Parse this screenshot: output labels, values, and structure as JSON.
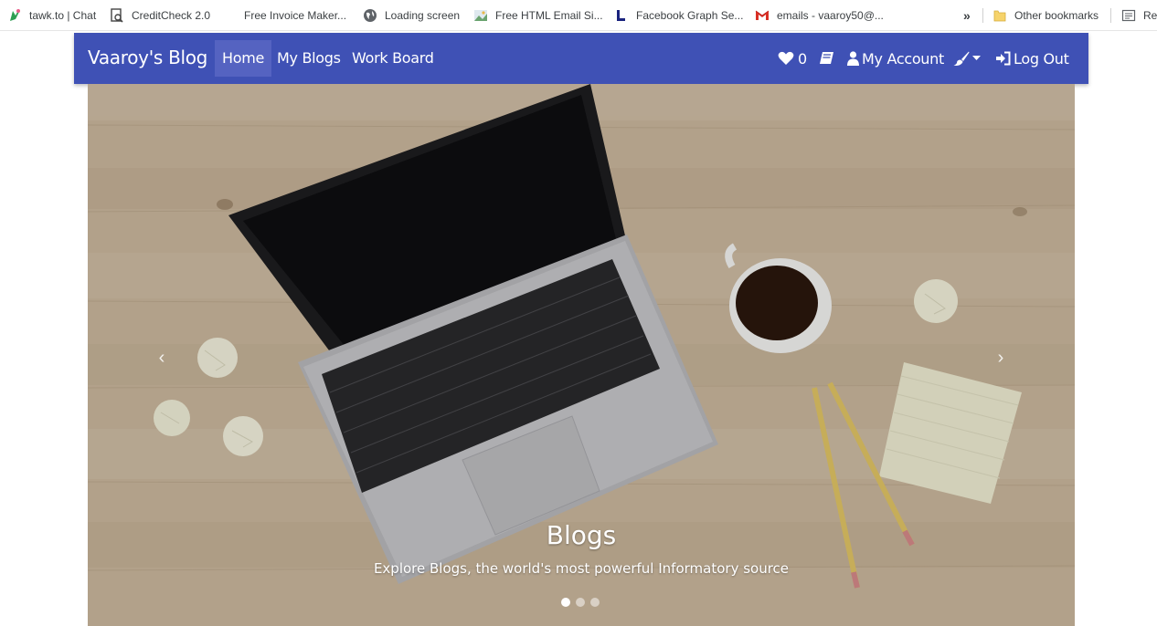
{
  "bookmarks": {
    "items": [
      {
        "label": "tawk.to | Chat",
        "icon": "tawk-icon"
      },
      {
        "label": "CreditCheck 2.0",
        "icon": "magnifier-doc-icon"
      },
      {
        "label": "Free Invoice Maker...",
        "icon": "invoice-icon"
      },
      {
        "label": "Loading screen",
        "icon": "globe-icon"
      },
      {
        "label": "Free HTML Email Si...",
        "icon": "email-signature-icon"
      },
      {
        "label": "Facebook Graph Se...",
        "icon": "facebook-graph-icon"
      },
      {
        "label": "emails - vaaroy50@...",
        "icon": "gmail-icon"
      }
    ],
    "more_label": "»",
    "other_label": "Other bookmarks",
    "reading_label": "Rea"
  },
  "navbar": {
    "brand": "Vaaroy's Blog",
    "links": [
      {
        "label": "Home",
        "active": true
      },
      {
        "label": "My Blogs",
        "active": false
      },
      {
        "label": "Work Board",
        "active": false
      }
    ],
    "likes_count": "0",
    "account_label": "My Account",
    "logout_label": "Log Out",
    "color": "#3f51b5"
  },
  "carousel": {
    "caption_title": "Blogs",
    "caption_text": "Explore Blogs, the world's most powerful Informatory source",
    "prev_label": "‹",
    "next_label": "›",
    "slides": 3,
    "active_slide": 1
  }
}
